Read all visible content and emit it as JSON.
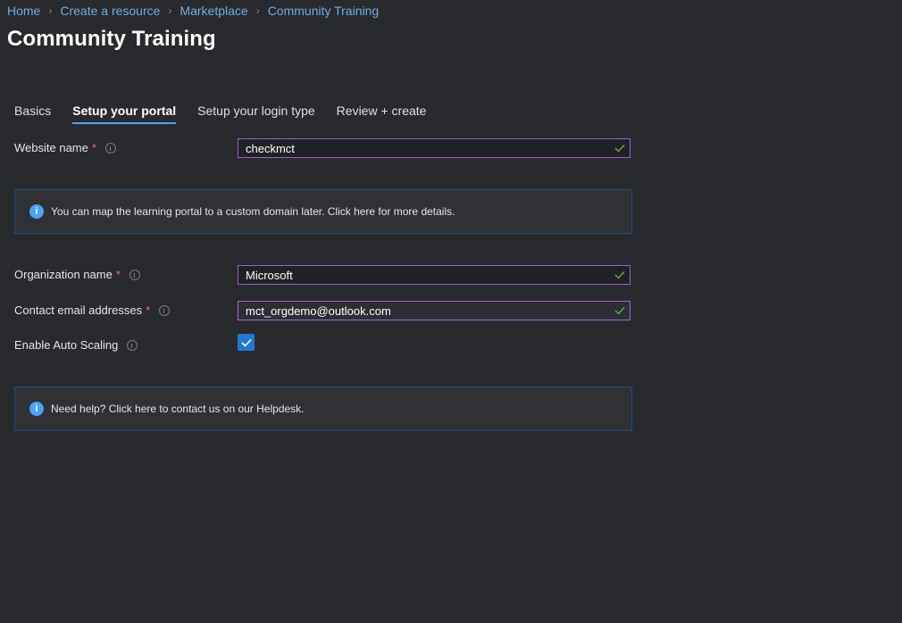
{
  "breadcrumb": {
    "items": [
      "Home",
      "Create a resource",
      "Marketplace",
      "Community Training"
    ]
  },
  "page": {
    "title": "Community Training"
  },
  "tabs": [
    {
      "label": "Basics"
    },
    {
      "label": "Setup your portal"
    },
    {
      "label": "Setup your login type"
    },
    {
      "label": "Review + create"
    }
  ],
  "form": {
    "website_name": {
      "label": "Website name",
      "required": "*",
      "value": "checkmct"
    },
    "organization_name": {
      "label": "Organization name",
      "required": "*",
      "value": "Microsoft"
    },
    "contact_email": {
      "label": "Contact email addresses",
      "required": "*",
      "value": "mct_orgdemo@outlook.com"
    },
    "auto_scaling": {
      "label": "Enable Auto Scaling",
      "checked": true
    }
  },
  "banners": {
    "domain": {
      "text": "You can map the learning portal to a custom domain later. Click here for more details."
    },
    "help": {
      "text": "Need help? Click here to contact us on our Helpdesk."
    }
  },
  "colors": {
    "background": "#292a2d",
    "accent": "#4aa3ff",
    "input_border": "#9f5fcf",
    "required": "#f1707b",
    "valid": "#5bb045"
  }
}
